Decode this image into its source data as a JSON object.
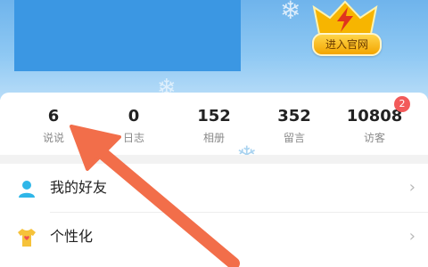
{
  "header": {
    "enter_label": "进入官网"
  },
  "stats": [
    {
      "value": "6",
      "label": "说说"
    },
    {
      "value": "0",
      "label": "日志"
    },
    {
      "value": "152",
      "label": "相册"
    },
    {
      "value": "352",
      "label": "留言"
    },
    {
      "value": "10808",
      "label": "访客"
    }
  ],
  "visitor_badge": "2",
  "menu": {
    "friends_label": "我的好友",
    "personalize_label": "个性化"
  },
  "colors": {
    "accent_arrow": "#f26e4a",
    "header_blue": "#3b97e3",
    "badge_red": "#f25a5a"
  }
}
